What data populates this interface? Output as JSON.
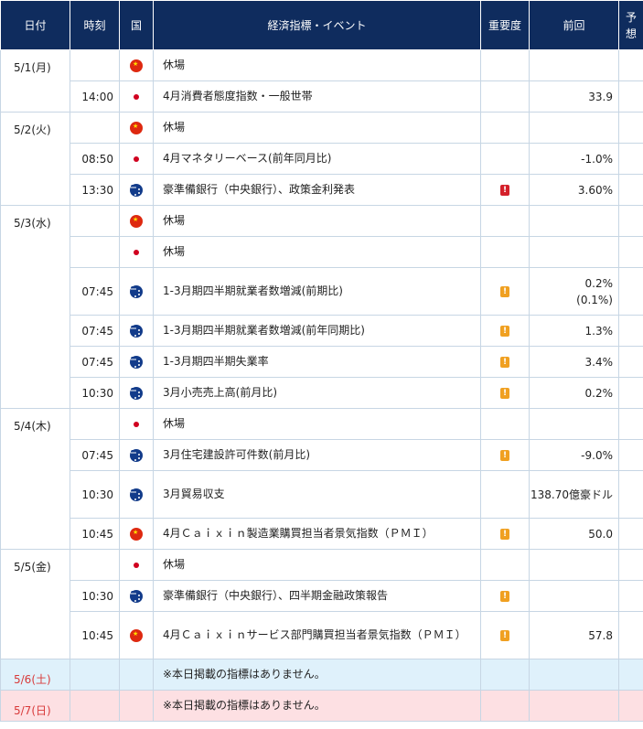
{
  "header": {
    "date": "日付",
    "time": "時刻",
    "country": "国",
    "event": "経済指標・イベント",
    "importance": "重要度",
    "previous": "前回",
    "forecast": "予想"
  },
  "days": [
    {
      "date": "5/1(月)",
      "rows": [
        {
          "time": "",
          "flag": "cn",
          "event": "休場",
          "importance": "",
          "previous": ""
        },
        {
          "time": "14:00",
          "flag": "jp",
          "event": "4月消費者態度指数・一般世帯",
          "importance": "",
          "previous": "33.9"
        }
      ]
    },
    {
      "date": "5/2(火)",
      "rows": [
        {
          "time": "",
          "flag": "cn",
          "event": "休場",
          "importance": "",
          "previous": ""
        },
        {
          "time": "08:50",
          "flag": "jp",
          "event": "4月マネタリーベース(前年同月比)",
          "importance": "",
          "previous": "-1.0%"
        },
        {
          "time": "13:30",
          "flag": "au",
          "event": "豪準備銀行（中央銀行）、政策金利発表",
          "importance": "high",
          "previous": "3.60%"
        }
      ]
    },
    {
      "date": "5/3(水)",
      "rows": [
        {
          "time": "",
          "flag": "cn",
          "event": "休場",
          "importance": "",
          "previous": ""
        },
        {
          "time": "",
          "flag": "jp",
          "event": "休場",
          "importance": "",
          "previous": ""
        },
        {
          "time": "07:45",
          "flag": "au",
          "event": "1-3月期四半期就業者数増減(前期比)",
          "importance": "mid",
          "previous": "0.2%",
          "previous_note": "(0.1%)",
          "tall": true
        },
        {
          "time": "07:45",
          "flag": "au",
          "event": "1-3月期四半期就業者数増減(前年同期比)",
          "importance": "mid",
          "previous": "1.3%"
        },
        {
          "time": "07:45",
          "flag": "au",
          "event": "1-3月期四半期失業率",
          "importance": "mid",
          "previous": "3.4%"
        },
        {
          "time": "10:30",
          "flag": "au",
          "event": "3月小売売上高(前月比)",
          "importance": "mid",
          "previous": "0.2%"
        }
      ]
    },
    {
      "date": "5/4(木)",
      "rows": [
        {
          "time": "",
          "flag": "jp",
          "event": "休場",
          "importance": "",
          "previous": ""
        },
        {
          "time": "07:45",
          "flag": "au",
          "event": "3月住宅建設許可件数(前月比)",
          "importance": "mid",
          "previous": "-9.0%"
        },
        {
          "time": "10:30",
          "flag": "au",
          "event": "3月貿易収支",
          "importance": "",
          "previous": "138.70億豪ドル",
          "tall": true
        },
        {
          "time": "10:45",
          "flag": "cn",
          "event": "4月Ｃａｉｘｉｎ製造業購買担当者景気指数（ＰＭＩ）",
          "importance": "mid",
          "previous": "50.0"
        }
      ]
    },
    {
      "date": "5/5(金)",
      "rows": [
        {
          "time": "",
          "flag": "jp",
          "event": "休場",
          "importance": "",
          "previous": ""
        },
        {
          "time": "10:30",
          "flag": "au",
          "event": "豪準備銀行（中央銀行）、四半期金融政策報告",
          "importance": "mid",
          "previous": ""
        },
        {
          "time": "10:45",
          "flag": "cn",
          "event": "4月Ｃａｉｘｉｎサービス部門購買担当者景気指数（ＰＭＩ）",
          "importance": "mid",
          "previous": "57.8",
          "tall": true
        }
      ]
    }
  ],
  "weekend": [
    {
      "date": "5/6(土)",
      "text": "※本日掲載の指標はありません。",
      "kind": "sat"
    },
    {
      "date": "5/7(日)",
      "text": "※本日掲載の指標はありません。",
      "kind": "sun"
    }
  ],
  "importance_glyph": "!",
  "colors": {
    "header_bg": "#0f2c5e",
    "importance_high": "#d4202a",
    "importance_mid": "#f0a021",
    "saturday_bg": "#dff1fb",
    "sunday_bg": "#fde0e3",
    "weekend_text": "#d83a3a"
  }
}
